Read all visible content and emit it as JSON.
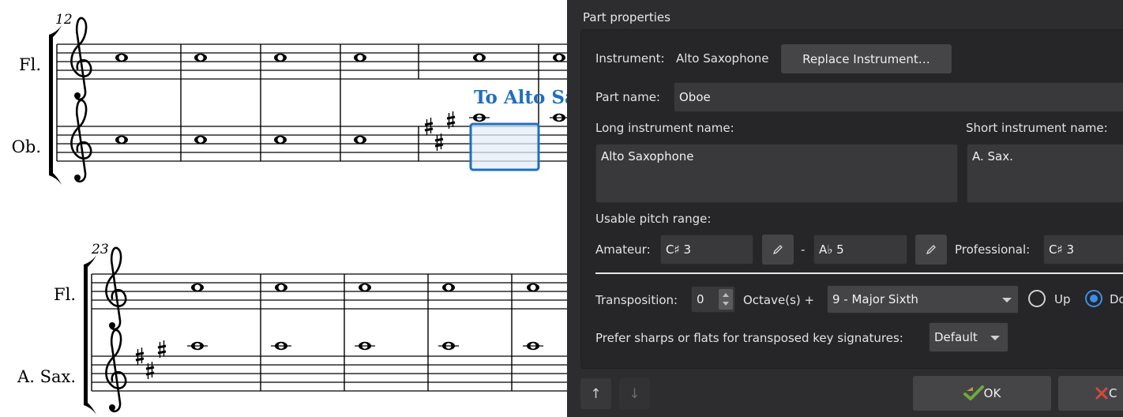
{
  "score": {
    "system1": {
      "measure_number": "12",
      "staff1_name": "Fl.",
      "staff2_name": "Ob.",
      "staff_text": "To Alto Sax."
    },
    "system2": {
      "measure_number": "23",
      "staff1_name": "Fl.",
      "staff2_name": "A. Sax."
    }
  },
  "dialog": {
    "title": "Part properties",
    "instrument_label": "Instrument:",
    "instrument_value": "Alto Saxophone",
    "replace_button": "Replace Instrument…",
    "part_name_label": "Part name:",
    "part_name_value": "Oboe",
    "long_name_label": "Long instrument name:",
    "long_name_value": "Alto Saxophone",
    "short_name_label": "Short instrument name:",
    "short_name_value": "A. Sax.",
    "pitch_range_label": "Usable pitch range:",
    "amateur_label": "Amateur:",
    "amateur_low": "C♯ 3",
    "range_dash": "-",
    "amateur_high": "A♭ 5",
    "professional_label": "Professional:",
    "professional_low": "C♯ 3",
    "transposition_label": "Transposition:",
    "octave_value": "0",
    "octaves_label": "Octave(s) +",
    "interval_value": "9 - Major Sixth",
    "up_label": "Up",
    "down_label": "Do",
    "prefer_label": "Prefer sharps or flats for transposed key signatures:",
    "prefer_value": "Default",
    "ok_button": "OK",
    "cancel_button": "C",
    "move_up_glyph": "↑",
    "move_down_glyph": "↓"
  },
  "colors": {
    "dialog_bg": "#2d2d30",
    "accent": "#3d8ee8",
    "score_text_blue": "#1f6fc0",
    "selection": "#1f6fc0"
  }
}
